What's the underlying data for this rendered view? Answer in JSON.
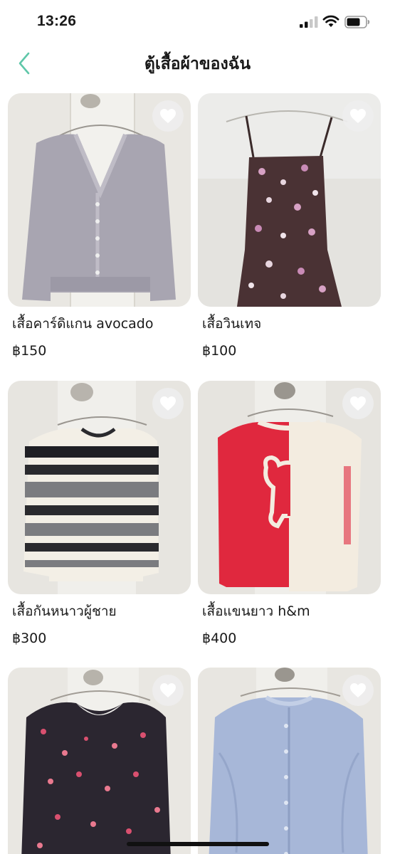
{
  "status": {
    "time": "13:26",
    "icons": [
      "signal-icon",
      "wifi-icon",
      "battery-icon"
    ]
  },
  "header": {
    "title": "ตู้เสื้อผ้าของฉัน",
    "back_icon": "chevron-left-icon",
    "accent_color": "#5fc7a9"
  },
  "products": [
    {
      "name": "เสื้อคาร์ดิแกน avocado",
      "price": "฿150",
      "favorite_icon": "heart-icon"
    },
    {
      "name": "เสื้อวินเทจ",
      "price": "฿100",
      "favorite_icon": "heart-icon"
    },
    {
      "name": "เสื้อกันหนาวผู้ชาย",
      "price": "฿300",
      "favorite_icon": "heart-icon"
    },
    {
      "name": "เสื้อแขนยาว h&m",
      "price": "฿400",
      "favorite_icon": "heart-icon"
    },
    {
      "name": "",
      "price": "",
      "favorite_icon": "heart-icon"
    },
    {
      "name": "",
      "price": "",
      "favorite_icon": "heart-icon"
    }
  ]
}
